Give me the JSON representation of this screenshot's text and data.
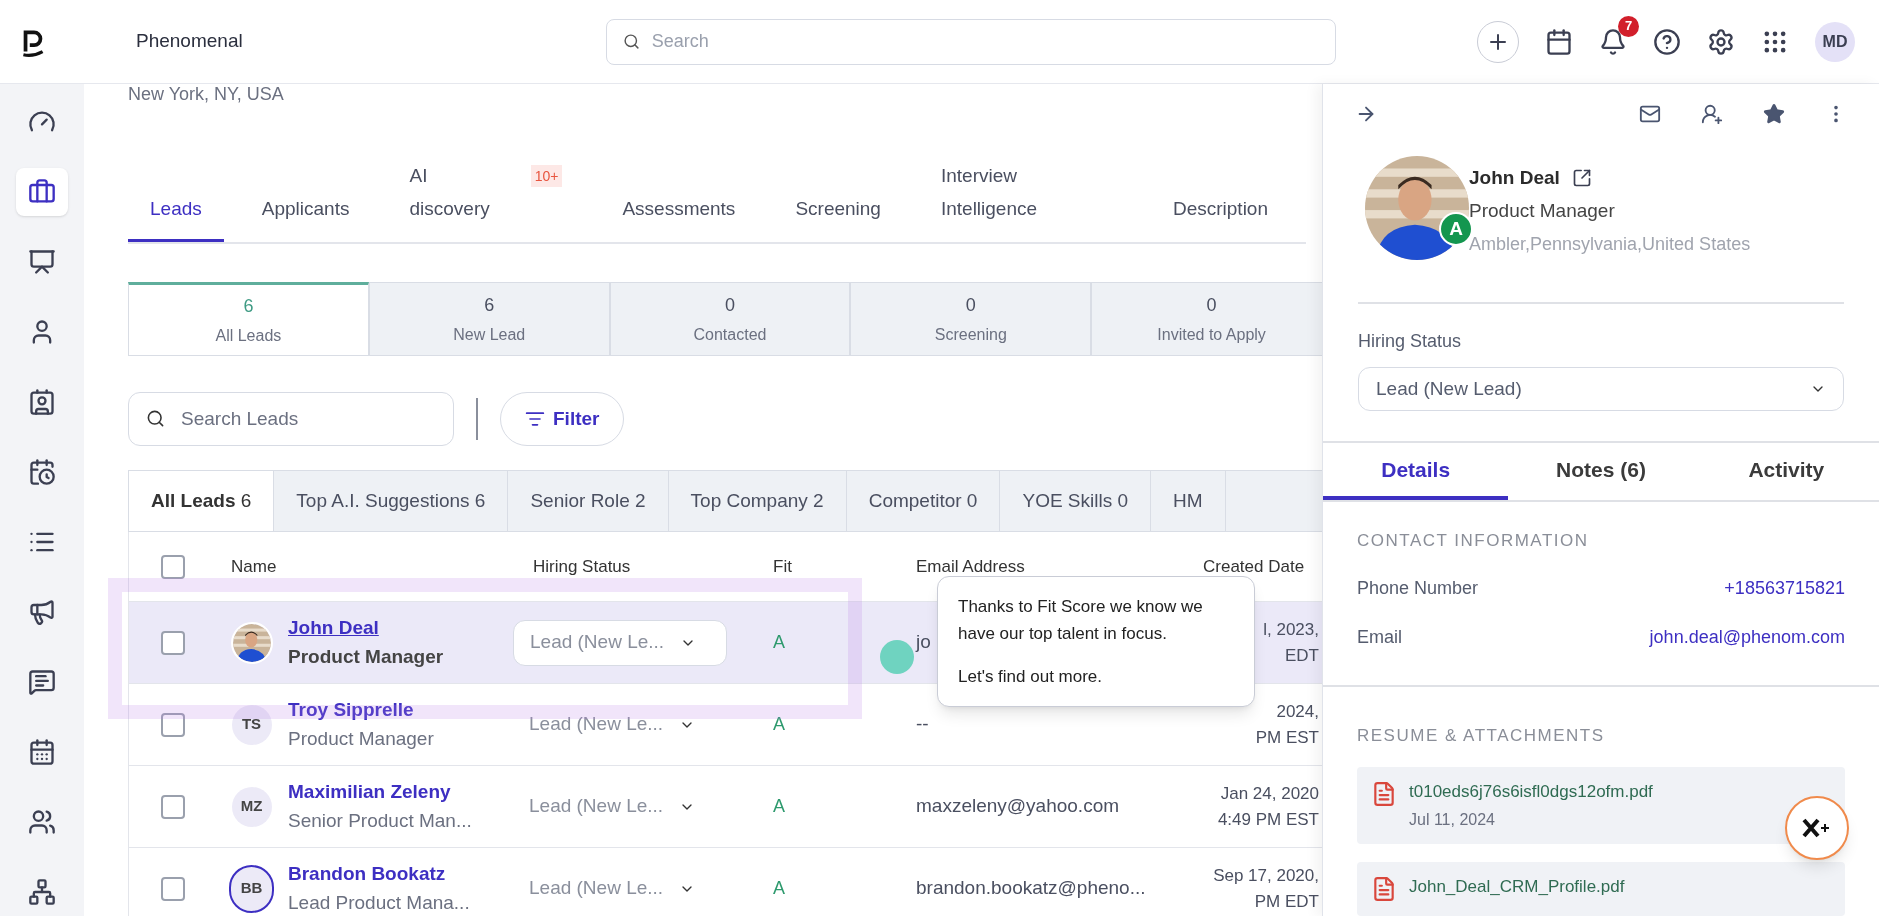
{
  "app": {
    "name": "Phenomenal",
    "search_placeholder": "Search",
    "notifications": "7",
    "user_initials": "MD"
  },
  "sidebar": {
    "items": [
      {
        "kind": "gauge",
        "selected": false
      },
      {
        "kind": "briefcase",
        "selected": true
      },
      {
        "kind": "presentation",
        "selected": false
      },
      {
        "kind": "user",
        "selected": false
      },
      {
        "kind": "contact",
        "selected": false
      },
      {
        "kind": "calendar-clock",
        "selected": false
      },
      {
        "kind": "list",
        "selected": false
      },
      {
        "kind": "megaphone",
        "selected": false
      },
      {
        "kind": "message",
        "selected": false
      },
      {
        "kind": "calendar",
        "selected": false
      },
      {
        "kind": "users",
        "selected": false
      },
      {
        "kind": "network",
        "selected": false
      }
    ]
  },
  "location": "New York, NY, USA",
  "tabs": [
    {
      "label": "Leads",
      "selected": true
    },
    {
      "label": "Applicants",
      "selected": false
    },
    {
      "label": "AI discovery",
      "badge": "10+",
      "selected": false
    },
    {
      "label": "Assessments",
      "selected": false
    },
    {
      "label": "Screening",
      "selected": false
    },
    {
      "label": "Interview Intelligence",
      "selected": false
    },
    {
      "label": "Description",
      "selected": false
    }
  ],
  "stages": [
    {
      "count": "6",
      "label": "All Leads",
      "selected": true
    },
    {
      "count": "6",
      "label": "New Lead",
      "selected": false
    },
    {
      "count": "0",
      "label": "Contacted",
      "selected": false
    },
    {
      "count": "0",
      "label": "Screening",
      "selected": false
    },
    {
      "count": "0",
      "label": "Invited to Apply",
      "selected": false
    }
  ],
  "search_leads": {
    "placeholder": "Search Leads"
  },
  "filter_button": "Filter",
  "filter_tabs": [
    {
      "label": "All Leads",
      "count": "6",
      "selected": true
    },
    {
      "label": "Top A.I. Suggestions",
      "count": "6",
      "selected": false
    },
    {
      "label": "Senior Role",
      "count": "2",
      "selected": false
    },
    {
      "label": "Top Company",
      "count": "2",
      "selected": false
    },
    {
      "label": "Competitor",
      "count": "0",
      "selected": false
    },
    {
      "label": "YOE Skills",
      "count": "0",
      "selected": false
    },
    {
      "label": "HM",
      "selected": false
    }
  ],
  "table": {
    "select_all_checked": false,
    "columns": [
      "Name",
      "Hiring Status",
      "Fit",
      "Email Address",
      "Created Date"
    ],
    "rows": [
      {
        "avatar": {
          "kind": "picture"
        },
        "name": "John Deal",
        "title": "Product Manager",
        "status": "Lead (New Le...",
        "fit": "A",
        "email": "jo",
        "created": [
          "l, 2023,",
          "EDT"
        ],
        "checked": false,
        "highlighted": true
      },
      {
        "avatar": {
          "kind": "initials",
          "text": "TS",
          "ring": false
        },
        "name": "Troy Sipprelle",
        "title": "Product Manager",
        "status": "Lead (New Le...",
        "fit": "A",
        "email": "--",
        "created": [
          "2024,",
          "PM EST"
        ],
        "checked": false,
        "highlighted": false
      },
      {
        "avatar": {
          "kind": "initials",
          "text": "MZ",
          "ring": false
        },
        "name": "Maximilian Zeleny",
        "title": "Senior Product Man...",
        "status": "Lead (New Le...",
        "fit": "A",
        "email": "maxzeleny@yahoo.com",
        "created": [
          "Jan 24, 2020",
          "4:49 PM EST"
        ],
        "checked": false,
        "highlighted": false
      },
      {
        "avatar": {
          "kind": "initials",
          "text": "BB",
          "ring": true
        },
        "name": "Brandon Bookatz",
        "title": "Lead Product Mana...",
        "status": "Lead (New Le...",
        "fit": "A",
        "email": "brandon.bookatz@pheno...",
        "created": [
          "Sep 17, 2020,",
          "PM EDT"
        ],
        "checked": false,
        "highlighted": false
      }
    ]
  },
  "tooltip": {
    "lines": [
      "Thanks to Fit Score we know we have our top talent in focus.",
      "Let's find out more."
    ]
  },
  "panel": {
    "name": "John Deal",
    "title": "Product Manager",
    "location": "Ambler,Pennsylvania,United States",
    "fit_badge": "A",
    "hiring_status_label": "Hiring Status",
    "hiring_status": "Lead (New Lead)",
    "tabs": [
      {
        "label": "Details",
        "selected": true
      },
      {
        "label": "Notes (6)",
        "selected": false
      },
      {
        "label": "Activity",
        "selected": false
      }
    ],
    "contact_heading": "CONTACT INFORMATION",
    "contact": [
      {
        "label": "Phone Number",
        "value": "+18563715821"
      },
      {
        "label": "Email",
        "value": "john.deal@phenom.com"
      }
    ],
    "attachments_heading": "RESUME & ATTACHMENTS",
    "attachments": [
      {
        "file": "t010eds6j76s6isfl0dgs12ofm.pdf",
        "date": "Jul 11, 2024"
      },
      {
        "file": "John_Deal_CRM_Profile.pdf"
      }
    ]
  }
}
